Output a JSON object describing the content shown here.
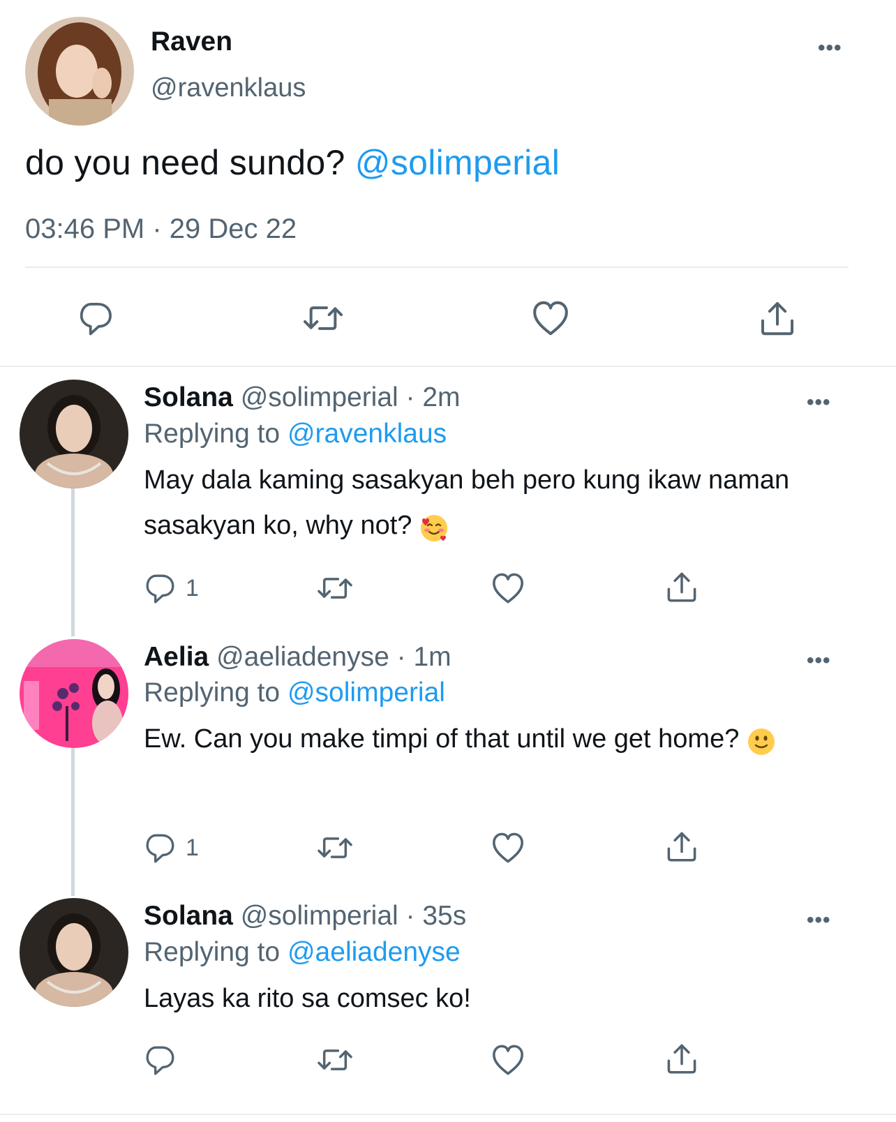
{
  "main_tweet": {
    "author_name": "Raven",
    "author_handle": "@ravenklaus",
    "text": "do you need sundo?",
    "mention": "@solimperial",
    "timestamp": "03:46 PM · 29 Dec 22",
    "more_icon": "more-horizontal-icon",
    "actions": [
      "reply-icon",
      "retweet-icon",
      "like-icon",
      "share-icon"
    ]
  },
  "replies": [
    {
      "name": "Solana",
      "handle_time": "@solimperial · 2m",
      "replying_prefix": "Replying to",
      "replying_to": "@ravenklaus",
      "text": "May dala kaming sasakyan beh pero kung ikaw naman sasakyan ko, why not?",
      "emoji": "smiling-face-with-hearts",
      "reply_count": "1"
    },
    {
      "name": "Aelia",
      "handle_time": "@aeliadenyse · 1m",
      "replying_prefix": "Replying to",
      "replying_to": "@solimperial",
      "text": "Ew. Can you make timpi of that until we get home?",
      "emoji": "slightly-smiling-face",
      "reply_count": "1"
    },
    {
      "name": "Solana",
      "handle_time": "@solimperial · 35s",
      "replying_prefix": "Replying to",
      "replying_to": "@aeliadenyse",
      "text": "Layas ka rito sa comsec ko!",
      "reply_count": ""
    }
  ],
  "colors": {
    "link": "#1d9bf0",
    "muted": "#536471",
    "divider": "#e6ecf0",
    "thread_line": "#cfd9de"
  }
}
